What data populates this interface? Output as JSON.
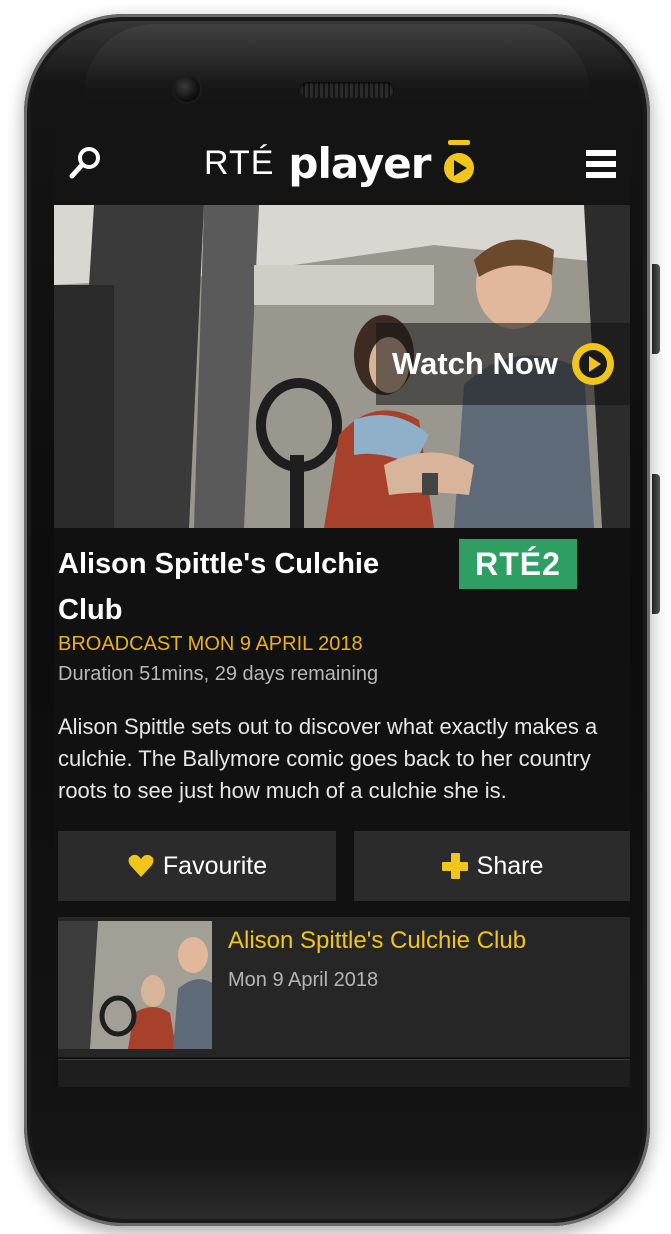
{
  "header": {
    "logo_rte": "RTÉ",
    "logo_player": "player"
  },
  "hero": {
    "watch_now_label": "Watch Now"
  },
  "programme": {
    "title": "Alison Spittle's Culchie Club",
    "channel": "RTÉ2",
    "broadcast": "BROADCAST MON 9 APRIL 2018",
    "duration": "Duration 51mins, 29 days remaining",
    "description": "Alison Spittle sets out to discover what exactly makes a culchie. The Ballymore comic goes back to her country roots to see just how much of a culchie she is."
  },
  "actions": {
    "favourite_label": "Favourite",
    "share_label": "Share"
  },
  "episodes": [
    {
      "title": "Alison Spittle's Culchie Club",
      "date": "Mon 9 April 2018"
    }
  ],
  "colors": {
    "accent": "#f2c51a",
    "channel_green": "#2e9e63",
    "background": "#111111"
  },
  "icons": [
    "search-icon",
    "menu-icon",
    "play-icon",
    "heart-icon",
    "plus-icon"
  ]
}
